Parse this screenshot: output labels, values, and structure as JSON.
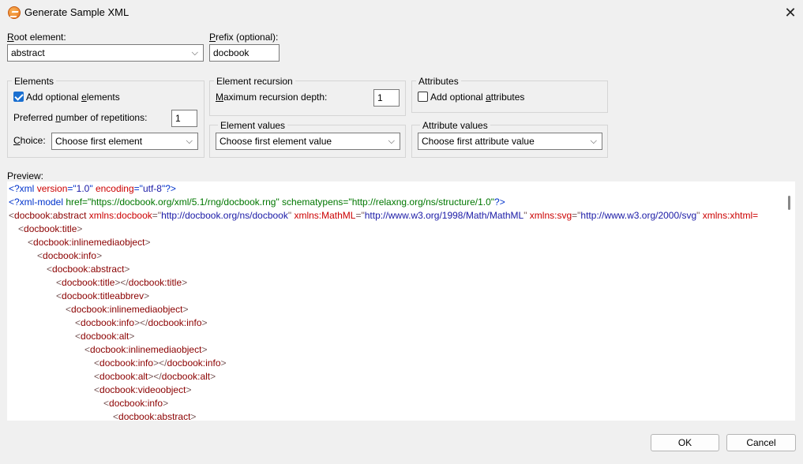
{
  "window": {
    "title": "Generate Sample XML"
  },
  "root_element": {
    "label": "Root element:",
    "value": "abstract"
  },
  "prefix": {
    "label": "Prefix (optional):",
    "value": "docbook"
  },
  "elements_group": {
    "title": "Elements",
    "add_optional_label": "Add optional elements",
    "add_optional_checked": true,
    "repetitions_label": "Preferred number of repetitions:",
    "repetitions_value": "1",
    "choice_label": "Choice:",
    "choice_value": "Choose first element"
  },
  "recursion_group": {
    "title": "Element recursion",
    "depth_label": "Maximum recursion depth:",
    "depth_value": "1"
  },
  "attributes_group": {
    "title": "Attributes",
    "add_optional_label": "Add optional attributes",
    "add_optional_checked": false
  },
  "element_values_group": {
    "title": "Element values",
    "value": "Choose first element value"
  },
  "attribute_values_group": {
    "title": "Attribute values",
    "value": "Choose first attribute value"
  },
  "preview": {
    "label": "Preview:",
    "xml_decl": {
      "version": "1.0",
      "encoding": "utf-8"
    },
    "xml_model": {
      "href": "https://docbook.org/xml/5.1/rng/docbook.rng",
      "schematypens": "http://relaxng.org/ns/structure/1.0"
    },
    "root_line": {
      "tag": "docbook:abstract",
      "attrs": [
        {
          "name": "xmlns:docbook",
          "value": "http://docbook.org/ns/docbook"
        },
        {
          "name": "xmlns:MathML",
          "value": "http://www.w3.org/1998/Math/MathML"
        },
        {
          "name": "xmlns:svg",
          "value": "http://www.w3.org/2000/svg"
        }
      ],
      "trailing": "xmlns:xhtml="
    },
    "lines": [
      {
        "indent": 1,
        "open": "docbook:title"
      },
      {
        "indent": 2,
        "open": "docbook:inlinemediaobject"
      },
      {
        "indent": 3,
        "open": "docbook:info"
      },
      {
        "indent": 4,
        "open": "docbook:abstract"
      },
      {
        "indent": 5,
        "open": "docbook:title",
        "close": "docbook:title"
      },
      {
        "indent": 5,
        "open": "docbook:titleabbrev"
      },
      {
        "indent": 6,
        "open": "docbook:inlinemediaobject"
      },
      {
        "indent": 7,
        "open": "docbook:info",
        "close": "docbook:info"
      },
      {
        "indent": 7,
        "open": "docbook:alt"
      },
      {
        "indent": 8,
        "open": "docbook:inlinemediaobject"
      },
      {
        "indent": 9,
        "open": "docbook:info",
        "close": "docbook:info"
      },
      {
        "indent": 9,
        "open": "docbook:alt",
        "close": "docbook:alt"
      },
      {
        "indent": 9,
        "open": "docbook:videoobject"
      },
      {
        "indent": 10,
        "open": "docbook:info"
      },
      {
        "indent": 11,
        "open": "docbook:abstract"
      }
    ]
  },
  "buttons": {
    "ok": "OK",
    "cancel": "Cancel"
  }
}
